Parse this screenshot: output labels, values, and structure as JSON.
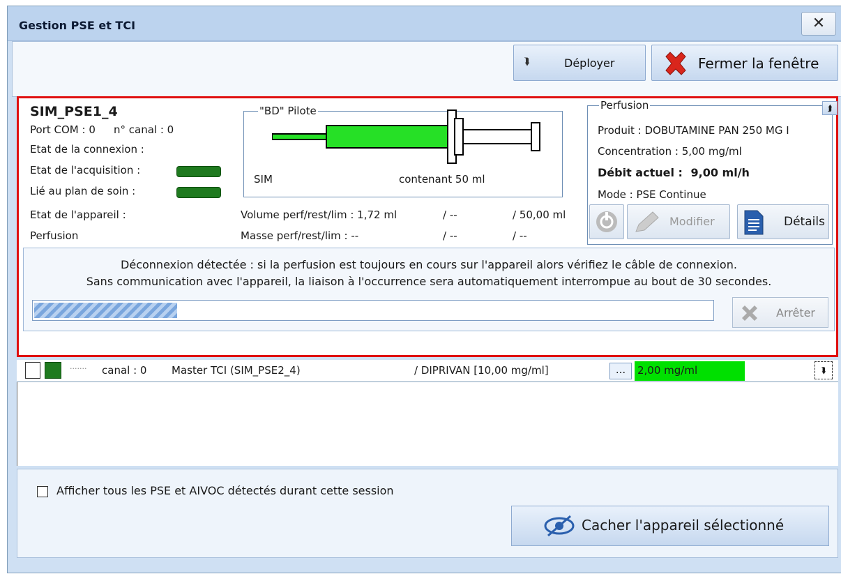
{
  "window": {
    "title": "Gestion PSE et TCI",
    "close_label": "✕"
  },
  "toolbar": {
    "deploy_label": "Déployer",
    "close_window_label": "Fermer la fenêtre"
  },
  "device": {
    "name": "SIM_PSE1_4",
    "port_com": "Port COM : 0",
    "canal": "n° canal : 0",
    "connexion": "Etat de la connexion :",
    "acquisition": "Etat de l'acquisition :",
    "lie_plan": "Lié au plan de soin :",
    "etat_appareil": "Etat de l'appareil :",
    "perfusion": "Perfusion",
    "syringe_legend": "\"BD\" Pilote",
    "syringe_sim": "SIM",
    "syringe_content": "contenant 50 ml",
    "vol_label": "Volume perf/rest/lim : 1,72 ml",
    "vol_rest": "/ --",
    "vol_lim": "/ 50,00 ml",
    "masse_label": "Masse perf/rest/lim : --",
    "masse_rest": "/ --",
    "masse_lim": "/ --",
    "syringe_fill_fraction": 0.55,
    "led_color": "#1f7a1f"
  },
  "perfusion": {
    "legend": "Perfusion",
    "produit": "Produit :  DOBUTAMINE PAN 250 MG I",
    "concentration": "Concentration : 5,00 mg/ml",
    "debit_label": "Débit actuel :",
    "debit_value": "9,00 ml/h",
    "mode": "Mode :  PSE Continue",
    "modifier_label": "Modifier",
    "details_label": "Détails"
  },
  "message": {
    "line1": "Déconnexion détectée : si la perfusion est toujours en cours sur l'appareil alors vérifiez le câble de connexion.",
    "line2": "Sans communication avec l'appareil, la liaison à l'occurrence sera automatiquement interrompue au bout de 30 secondes.",
    "progress_fraction": 0.21,
    "stop_label": "Arrêter"
  },
  "list_row": {
    "dots": "·······",
    "canal": "canal : 0",
    "name": "Master TCI (SIM_PSE2_4)",
    "product": "/ DIPRIVAN [10,00 mg/ml]",
    "more": "...",
    "value": "2,00 mg/ml",
    "value_bg": "#00e000"
  },
  "bottom": {
    "show_all_label": "Afficher tous les PSE et AIVOC détectés durant cette session",
    "hide_label": "Cacher l'appareil sélectionné"
  }
}
